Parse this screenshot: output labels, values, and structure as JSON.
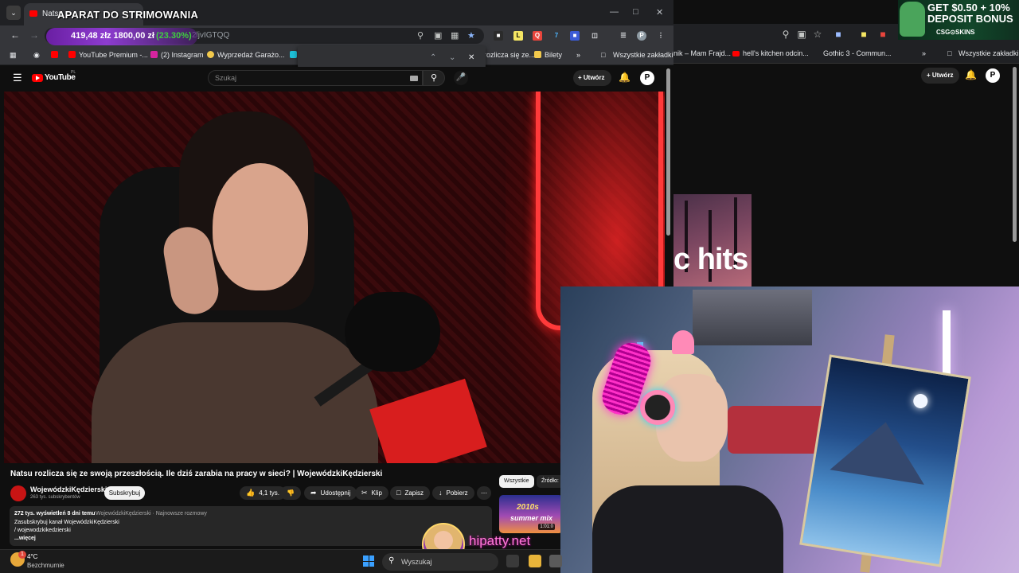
{
  "overlay": {
    "title": "APARAT DO STRIMOWANIA",
    "donation_amount": "419,48 zł",
    "donation_goal": "z 1800,00 zł",
    "donation_percent": "(23.30%)",
    "watermark": "hipatty.net"
  },
  "ad": {
    "line1": "GET $0.50 + 10%",
    "line2": "DEPOSIT BONUS",
    "brand": "CSG⊙SKINS"
  },
  "browser": {
    "tab_title": "Natsu",
    "url_fragment": "2ljvIGTQQ",
    "bookmarks": [
      {
        "label": "YouTube Premium -...",
        "color": "#ff0000"
      },
      {
        "label": "(2) Instagram",
        "color": "#d6249f"
      },
      {
        "label": "Wyprzedaż Garażo...",
        "color": "#f2c94c"
      },
      {
        "label": "rozlicza się ze...",
        "color": "#ff0000"
      },
      {
        "label": "Bilety",
        "color": "#f2c94c"
      }
    ],
    "all_bookmarks": "Wszystkie zakładki",
    "overflow": "»"
  },
  "bg_browser": {
    "bookmarks": [
      "nik – Mam Frajd...",
      "hell's kitchen odcin...",
      "Gothic 3 - Commun..."
    ],
    "all_bookmarks": "Wszystkie zakładki",
    "create": "+ Utwórz",
    "thumb_text": "c hits"
  },
  "youtube": {
    "logo": "YouTube",
    "logo_country": "PL",
    "search_placeholder": "Szukaj",
    "create": "+ Utwórz",
    "avatar": "P",
    "video_title": "Natsu rozlicza się ze swoją przeszłością. Ile dziś zarabia na pracy w sieci? | WojewódzkiKędzierski",
    "channel_name": "WojewódzkiKędzierski",
    "channel_subs": "263 tys. subskrybentów",
    "subscribe": "Subskrybuj",
    "likes": "4,1 tys.",
    "share": "Udostępnij",
    "clip": "Klip",
    "save": "Zapisz",
    "download": "Pobierz",
    "description": {
      "stats": "272 tys. wyświetleń  8 dni temu",
      "tags": "WojewódzkiKędzierski · Najnowsze rozmowy",
      "line2": "Zasubskrybuj kanał WojewódzkiKędzierski",
      "line3": "/ wojewodzkikedzierski",
      "more": "...więcej"
    },
    "chips": [
      "Wszystkie",
      "Źródło:"
    ],
    "reco": {
      "t1": "2010s",
      "t2": "summer mix",
      "time": "1:01:0"
    }
  },
  "taskbar": {
    "temp": "4°C",
    "condition": "Bezchmurnie",
    "search_placeholder": "Wyszukaj",
    "badge": "1"
  },
  "colors": {
    "accent_percent": "#3ed13e",
    "watermark": "#ff7ad8",
    "yt_red": "#ff0000"
  }
}
